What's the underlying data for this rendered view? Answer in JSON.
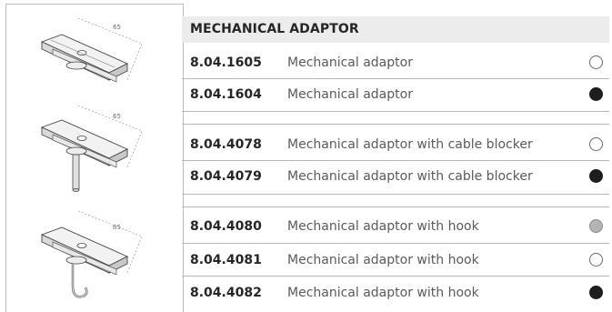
{
  "table": {
    "header": "MECHANICAL ADAPTOR",
    "groups": [
      {
        "rows": [
          {
            "code": "8.04.1605",
            "description": "Mechanical adaptor",
            "finish_color": "#ffffff"
          },
          {
            "code": "8.04.1604",
            "description": "Mechanical adaptor",
            "finish_color": "#1e1e1e"
          }
        ]
      },
      {
        "rows": [
          {
            "code": "8.04.4078",
            "description": "Mechanical adaptor with cable blocker",
            "finish_color": "#ffffff"
          },
          {
            "code": "8.04.4079",
            "description": "Mechanical adaptor with cable blocker",
            "finish_color": "#1e1e1e"
          }
        ]
      },
      {
        "rows": [
          {
            "code": "8.04.4080",
            "description": "Mechanical adaptor with hook",
            "finish_color": "#b4b4b4"
          },
          {
            "code": "8.04.4081",
            "description": "Mechanical adaptor with hook",
            "finish_color": "#ffffff"
          },
          {
            "code": "8.04.4082",
            "description": "Mechanical adaptor with hook",
            "finish_color": "#1e1e1e"
          }
        ]
      }
    ]
  },
  "illustrations": [
    {
      "name": "mechanical-adaptor-drawing",
      "dimension": "65"
    },
    {
      "name": "adaptor-with-cable-blocker-drawing",
      "dimension": "65"
    },
    {
      "name": "adaptor-with-hook-drawing",
      "dimension": "65"
    }
  ]
}
